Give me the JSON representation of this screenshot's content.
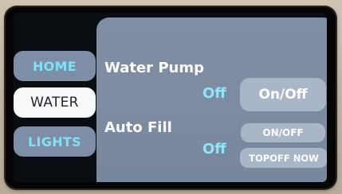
{
  "nav": {
    "items": [
      {
        "label": "HOME",
        "active": false
      },
      {
        "label": "WATER",
        "active": true
      },
      {
        "label": "LIGHTS",
        "active": false
      }
    ]
  },
  "water_pump": {
    "title": "Water Pump",
    "status": "Off",
    "toggle_label": "On/Off"
  },
  "auto_fill": {
    "title": "Auto Fill",
    "status": "Off",
    "toggle_label": "ON/OFF",
    "topoff_label": "TOPOFF NOW"
  },
  "colors": {
    "nav_inactive_bg": "#7d8ea6",
    "nav_inactive_text": "#7ee2f7",
    "nav_active_bg": "#f7f9fb",
    "panel_bg": "#7f8ea3",
    "button_bg": "#a8b6c8",
    "status_text": "#8ee6fb"
  }
}
